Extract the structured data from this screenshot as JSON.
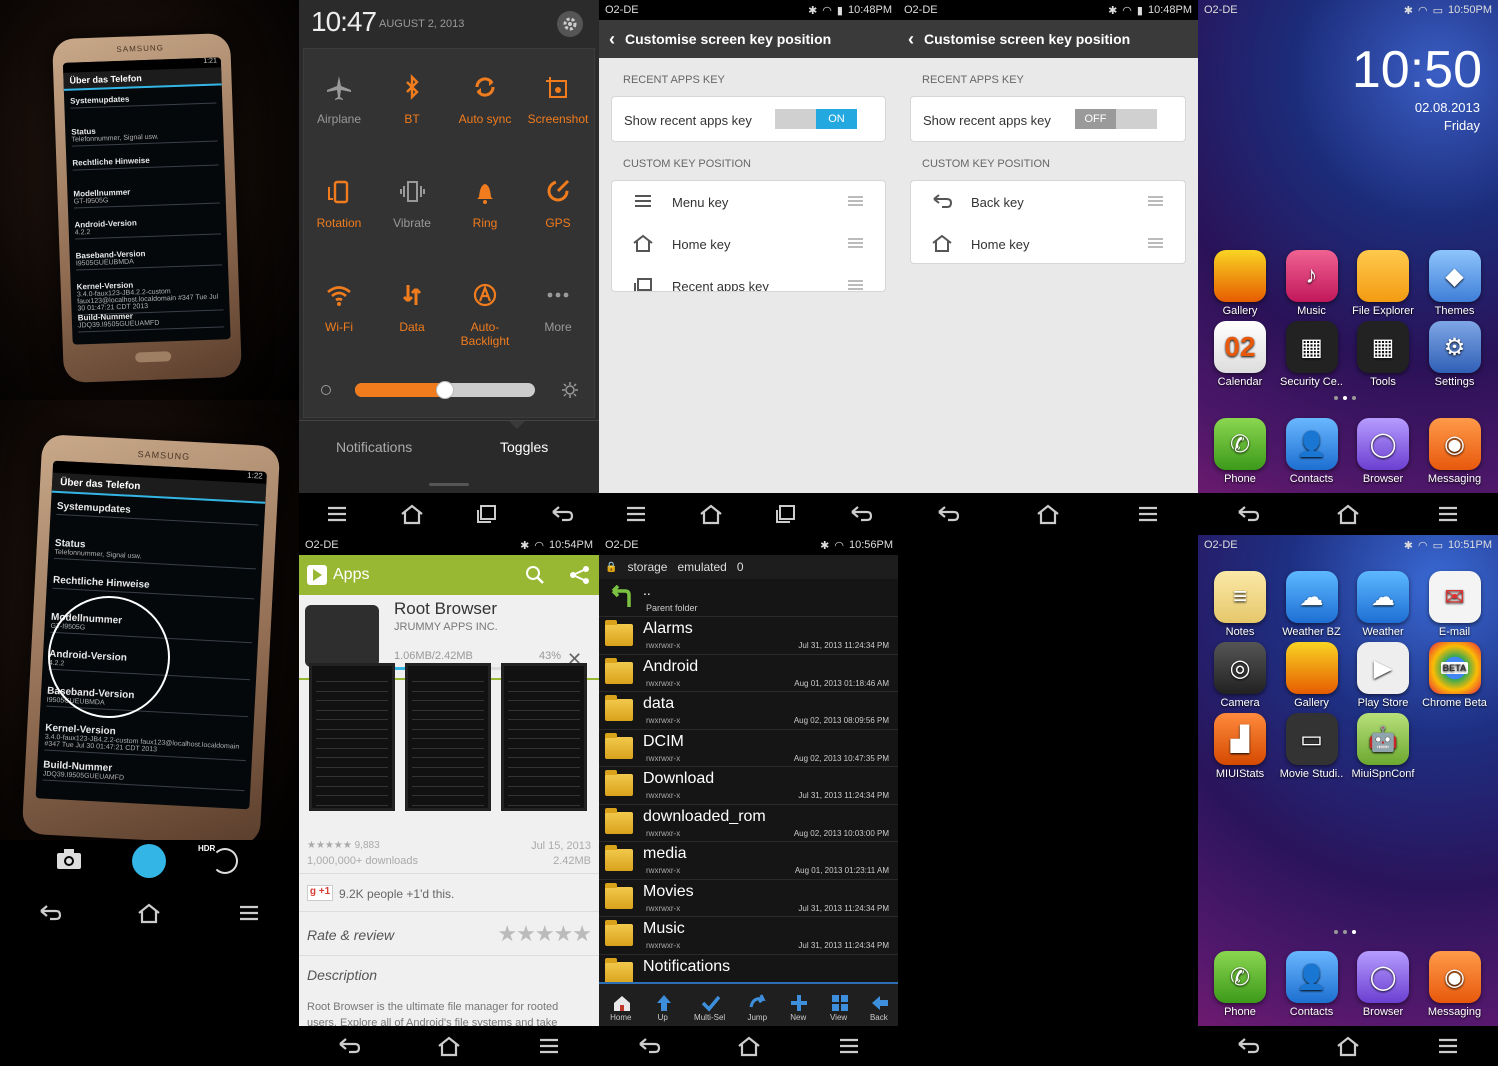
{
  "photo1": {
    "brand": "SAMSUNG",
    "time": "1:21",
    "title": "Über das Telefon",
    "rows": [
      {
        "label": "Systemupdates",
        "sub": ""
      },
      {
        "label": "Status",
        "sub": "Telefonnummer, Signal usw."
      },
      {
        "label": "Rechtliche Hinweise",
        "sub": ""
      },
      {
        "label": "Modellnummer",
        "sub": "GT-I9505G"
      },
      {
        "label": "Android-Version",
        "sub": "4.2.2"
      },
      {
        "label": "Baseband-Version",
        "sub": "I9505GUEUBMDA"
      },
      {
        "label": "Kernel-Version",
        "sub": "3.4.0-faux123-JB4.2.2-custom faux123@localhost.localdomain #347 Tue Jul 30 01:47:21 CDT 2013"
      },
      {
        "label": "Build-Nummer",
        "sub": "JDQ39.I9505GUEUAMFD"
      }
    ]
  },
  "photo2": {
    "brand": "SAMSUNG",
    "time": "1:22",
    "title": "Über das Telefon",
    "rows": [
      {
        "label": "Systemupdates",
        "sub": ""
      },
      {
        "label": "Status",
        "sub": "Telefonnummer, Signal usw."
      },
      {
        "label": "Rechtliche Hinweise",
        "sub": ""
      },
      {
        "label": "Modellnummer",
        "sub": "GT-I9505G"
      },
      {
        "label": "Android-Version",
        "sub": "4.2.2"
      },
      {
        "label": "Baseband-Version",
        "sub": "I9505GUEUBMDA"
      },
      {
        "label": "Kernel-Version",
        "sub": "3.4.0-faux123-JB4.2.2-custom faux123@localhost.localdomain #347 Tue Jul 30 01:47:21 CDT 2013"
      },
      {
        "label": "Build-Nummer",
        "sub": "JDQ39.I9505GUEUAMFD"
      }
    ],
    "hdr_label": "HDR"
  },
  "toggles": {
    "time": "10:47",
    "date": "AUGUST 2, 2013",
    "items": [
      {
        "label": "Airplane",
        "on": false
      },
      {
        "label": "BT",
        "on": true
      },
      {
        "label": "Auto sync",
        "on": true
      },
      {
        "label": "Screenshot",
        "on": true
      },
      {
        "label": "Rotation",
        "on": true
      },
      {
        "label": "Vibrate",
        "on": false
      },
      {
        "label": "Ring",
        "on": true
      },
      {
        "label": "GPS",
        "on": true
      },
      {
        "label": "Wi-Fi",
        "on": true
      },
      {
        "label": "Data",
        "on": true
      },
      {
        "label": "Auto-\nBacklight",
        "on": true
      },
      {
        "label": "More",
        "on": false
      }
    ],
    "brightness": 0.5,
    "tabs": [
      "Notifications",
      "Toggles"
    ],
    "active_tab": "Toggles"
  },
  "settings1": {
    "status": {
      "carrier": "O2-DE",
      "time": "10:48PM"
    },
    "title": "Customise screen key position",
    "section1": "RECENT APPS KEY",
    "show_label": "Show recent apps key",
    "switch_text": "ON",
    "section2": "CUSTOM KEY POSITION",
    "keys": [
      "Menu key",
      "Home key",
      "Recent apps key"
    ]
  },
  "settings2": {
    "status": {
      "carrier": "O2-DE",
      "time": "10:48PM"
    },
    "title": "Customise screen key position",
    "section1": "RECENT APPS KEY",
    "show_label": "Show recent apps key",
    "switch_text": "OFF",
    "section2": "CUSTOM KEY POSITION",
    "keys": [
      "Back key",
      "Home key"
    ]
  },
  "home1": {
    "status": {
      "carrier": "O2-DE",
      "time": "10:50PM"
    },
    "clock": "10:50",
    "date": "02.08.2013",
    "day": "Friday",
    "apps": [
      "Gallery",
      "Music",
      "File Explorer",
      "Themes",
      "Calendar",
      "Security Ce..",
      "Tools",
      "Settings"
    ],
    "calendar_day": "02",
    "dock": [
      "Phone",
      "Contacts",
      "Browser",
      "Messaging"
    ]
  },
  "home2": {
    "status": {
      "carrier": "O2-DE",
      "time": "10:51PM"
    },
    "apps": [
      "Notes",
      "Weather BZ",
      "Weather",
      "E-mail",
      "Camera",
      "Gallery",
      "Play Store",
      "Chrome Beta",
      "MIUIStats",
      "Movie Studi..",
      "MiuiSpnConf"
    ],
    "beta_badge": "BETA",
    "dock": [
      "Phone",
      "Contacts",
      "Browser",
      "Messaging"
    ]
  },
  "store": {
    "status": {
      "carrier": "O2-DE",
      "time": "10:54PM"
    },
    "section": "Apps",
    "app_name": "Root Browser",
    "developer": "JRUMMY APPS INC.",
    "download_progress": "1.06MB/2.42MB",
    "percent": "43%",
    "progress_value": 0.43,
    "rating_count": "9,883",
    "downloads": "1,000,000+ downloads",
    "date": "Jul 15, 2013",
    "size": "2.42MB",
    "plus_one": "+1",
    "plus_one_text": "9.2K people +1'd this.",
    "rate_label": "Rate & review",
    "description_title": "Description",
    "description": "Root Browser is the ultimate file manager for rooted users. Explore all of Android's file systems and take"
  },
  "files": {
    "status": {
      "carrier": "O2-DE",
      "time": "10:56PM"
    },
    "path": [
      "storage",
      "emulated",
      "0"
    ],
    "parent": {
      "name": "..",
      "sub": "Parent folder"
    },
    "rows": [
      {
        "name": "Alarms",
        "perm": "rwxrwxr-x",
        "date": "Jul 31, 2013 11:24:34 PM"
      },
      {
        "name": "Android",
        "perm": "rwxrwxr-x",
        "date": "Aug 01, 2013 01:18:46 AM"
      },
      {
        "name": "data",
        "perm": "rwxrwxr-x",
        "date": "Aug 02, 2013 08:09:56 PM"
      },
      {
        "name": "DCIM",
        "perm": "rwxrwxr-x",
        "date": "Aug 02, 2013 10:47:35 PM"
      },
      {
        "name": "Download",
        "perm": "rwxrwxr-x",
        "date": "Jul 31, 2013 11:24:34 PM"
      },
      {
        "name": "downloaded_rom",
        "perm": "rwxrwxr-x",
        "date": "Aug 02, 2013 10:03:00 PM"
      },
      {
        "name": "media",
        "perm": "rwxrwxr-x",
        "date": "Aug 01, 2013 01:23:11 AM"
      },
      {
        "name": "Movies",
        "perm": "rwxrwxr-x",
        "date": "Jul 31, 2013 11:24:34 PM"
      },
      {
        "name": "Music",
        "perm": "rwxrwxr-x",
        "date": "Jul 31, 2013 11:24:34 PM"
      },
      {
        "name": "Notifications",
        "perm": "",
        "date": ""
      }
    ],
    "tools": [
      "Home",
      "Up",
      "Multi-Sel",
      "Jump",
      "New",
      "View",
      "Back"
    ]
  },
  "colors": {
    "accent_orange": "#f07c1e",
    "store_green": "#98b833",
    "switch_on": "#23a8e0",
    "fm_blue": "#2d6fb6"
  }
}
